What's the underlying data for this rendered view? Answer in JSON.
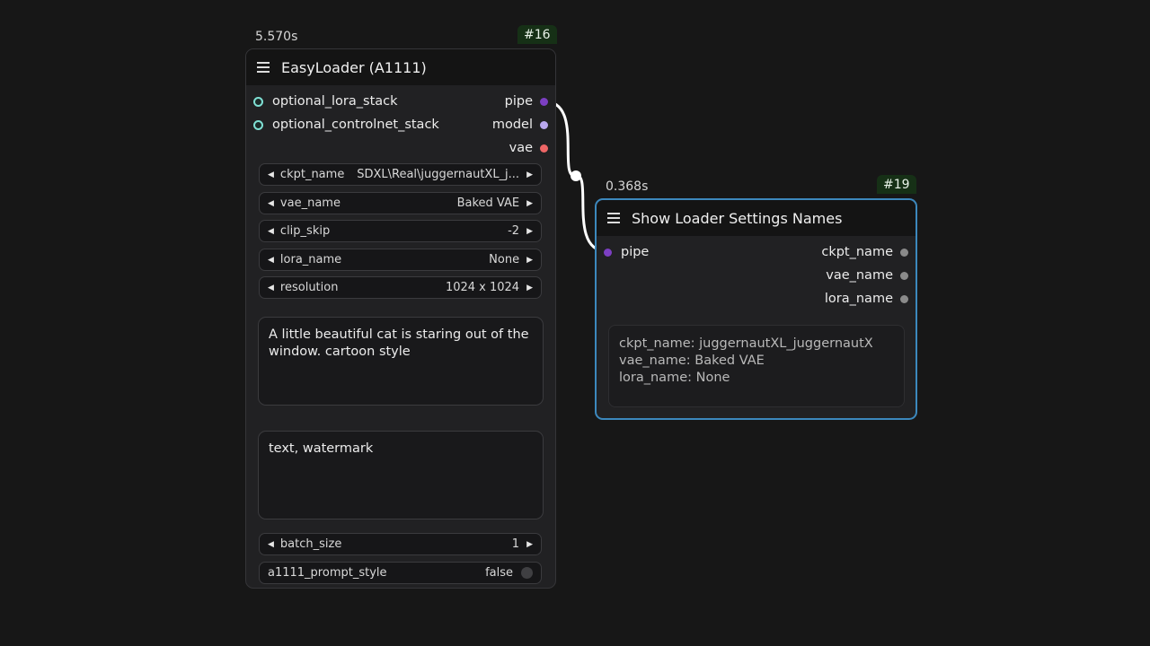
{
  "colors": {
    "canvas": "#171717",
    "node_bg": "#212123",
    "header_bg": "#141414",
    "selected_border": "#3c88bd",
    "pipe_slot": "#7c3fc2",
    "model_slot": "#b9a7ee",
    "vae_slot": "#ee6666",
    "string_slot": "#8a8a8a",
    "stack_slot": "#7fe0d4"
  },
  "easy_loader": {
    "exec_time": "5.570s",
    "id": "#16",
    "title": "EasyLoader (A1111)",
    "inputs": [
      {
        "label": "optional_lora_stack",
        "icon": "ring-dot"
      },
      {
        "label": "optional_controlnet_stack",
        "icon": "ring-dot"
      }
    ],
    "outputs": [
      {
        "label": "pipe",
        "icon": "dot",
        "color": "#7c3fc2"
      },
      {
        "label": "model",
        "icon": "dot",
        "color": "#b9a7ee"
      },
      {
        "label": "vae",
        "icon": "dot",
        "color": "#ee6666"
      }
    ],
    "widgets": [
      {
        "name": "ckpt_name",
        "value": "SDXL\\Real\\juggernautXL_j..."
      },
      {
        "name": "vae_name",
        "value": "Baked VAE"
      },
      {
        "name": "clip_skip",
        "value": "-2"
      },
      {
        "name": "lora_name",
        "value": "None"
      },
      {
        "name": "resolution",
        "value": "1024 x 1024"
      }
    ],
    "positive_prompt": "A little beautiful cat is staring out of the window. cartoon style",
    "negative_prompt": "text, watermark",
    "batch_size": {
      "name": "batch_size",
      "value": "1"
    },
    "prompt_style": {
      "name": "a1111_prompt_style",
      "value": "false"
    }
  },
  "show_loader": {
    "exec_time": "0.368s",
    "id": "#19",
    "title": "Show Loader Settings Names",
    "input": {
      "label": "pipe",
      "color": "#7c3fc2"
    },
    "outputs": [
      {
        "label": "ckpt_name"
      },
      {
        "label": "vae_name"
      },
      {
        "label": "lora_name"
      }
    ],
    "display_lines": [
      "ckpt_name: juggernautXL_juggernautX",
      "vae_name: Baked VAE",
      "lora_name: None"
    ]
  }
}
